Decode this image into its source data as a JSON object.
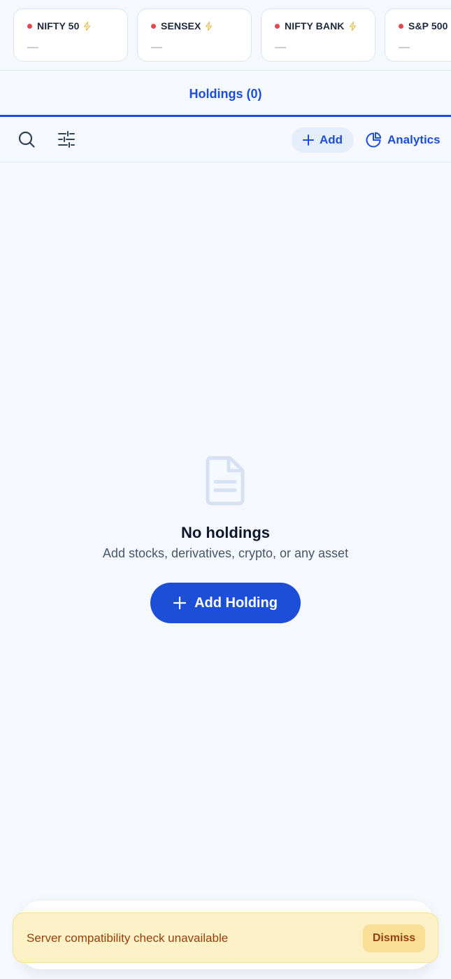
{
  "tickers": [
    {
      "name": "NIFTY 50",
      "value": "—"
    },
    {
      "name": "SENSEX",
      "value": "—"
    },
    {
      "name": "NIFTY BANK",
      "value": "—"
    },
    {
      "name": "S&P 500",
      "value": "—"
    }
  ],
  "tabs": {
    "holdings_label": "Holdings (0)"
  },
  "toolbar": {
    "add_label": "Add",
    "analytics_label": "Analytics"
  },
  "empty_state": {
    "title": "No holdings",
    "subtitle": "Add stocks, derivatives, crypto, or any asset",
    "button_label": "Add Holding"
  },
  "toast": {
    "message": "Server compatibility check unavailable",
    "dismiss_label": "Dismiss"
  },
  "colors": {
    "accent": "#1d4ed8",
    "status_dot": "#e5484d",
    "toast_bg": "#fdf1c8",
    "toast_text": "#92400e"
  }
}
